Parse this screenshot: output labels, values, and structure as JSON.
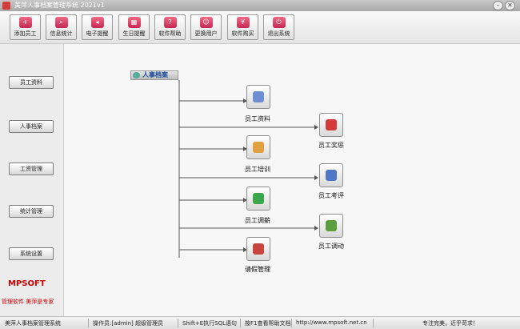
{
  "window": {
    "title": "美萍人事档案管理系统 2021v1",
    "min": "–",
    "max": "□",
    "close": "✕"
  },
  "toolbar": [
    "添加员工",
    "信息统计",
    "电子提醒",
    "生日提醒",
    "软件帮助",
    "更换用户",
    "软件购买",
    "退出系统"
  ],
  "sidebar": [
    "员工资料",
    "人事档案",
    "工资管理",
    "统计管理",
    "系统设置"
  ],
  "branding": {
    "logo": "MPSOFT",
    "slogan": "管理软件  美萍是专家"
  },
  "diagram": {
    "header": "人事档案",
    "nodes": {
      "staff_info": "员工资料",
      "training": "员工培训",
      "salary_adjust": "员工调薪",
      "leave": "请假管理",
      "reward_punish": "员工奖惩",
      "evaluation": "员工考评",
      "transfer": "员工调动"
    }
  },
  "status": {
    "app": "美萍人事档案管理系统",
    "operator": "操作员:[admin] 超级管理员",
    "sql_hint": "Shift+E执行SQL语句",
    "help_hint": "按F1查看帮助文档",
    "url": "http://www.mpsoft.net.cn",
    "motto": "专注完美，近乎苛求！"
  }
}
